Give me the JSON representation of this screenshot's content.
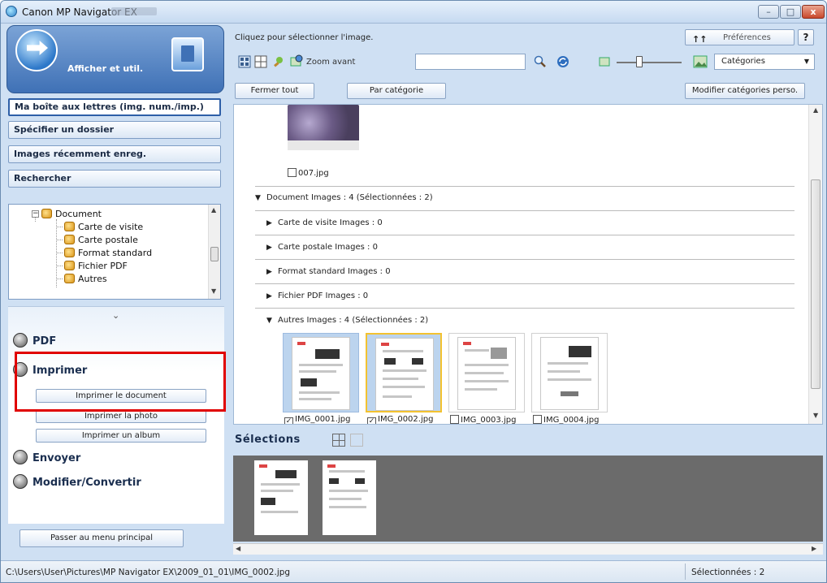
{
  "window": {
    "title": "Canon MP Navigator EX"
  },
  "left": {
    "header_title": "Afficher et util.",
    "nav": [
      {
        "label": "Ma boîte aux lettres (img. num./imp.)",
        "active": true
      },
      {
        "label": "Spécifier un dossier"
      },
      {
        "label": "Images récemment enreg."
      },
      {
        "label": "Rechercher"
      }
    ],
    "tree": {
      "root": "Document",
      "children": [
        "Carte de visite",
        "Carte postale",
        "Format standard",
        "Fichier PDF",
        "Autres"
      ]
    },
    "sections": {
      "pdf": "PDF",
      "print": "Imprimer",
      "print_doc": "Imprimer le document",
      "print_photo": "Imprimer la photo",
      "print_album": "Imprimer un album",
      "send": "Envoyer",
      "edit": "Modifier/Convertir"
    },
    "main_menu_btn": "Passer au menu principal"
  },
  "right": {
    "hint": "Cliquez pour sélectionner l'image.",
    "preferences": "Préférences",
    "help": "?",
    "zoom": "Zoom avant",
    "search_value": "",
    "select_value": "Catégories",
    "close_all": "Fermer tout",
    "by_category": "Par catégorie",
    "edit_categories": "Modifier catégories perso.",
    "photo_caption": "007.jpg",
    "groups": [
      {
        "text": "Document   Images : 4   (Sélectionnées : 2)"
      },
      {
        "text": "Carte de visite   Images : 0"
      },
      {
        "text": "Carte postale   Images : 0"
      },
      {
        "text": "Format standard   Images : 0"
      },
      {
        "text": "Fichier PDF   Images : 0"
      },
      {
        "text": "Autres   Images : 4   (Sélectionnées : 2)"
      }
    ],
    "thumbs": [
      {
        "name": "IMG_0001.jpg",
        "checked": true
      },
      {
        "name": "IMG_0002.jpg",
        "checked": true
      },
      {
        "name": "IMG_0003.jpg",
        "checked": false
      },
      {
        "name": "IMG_0004.jpg",
        "checked": false
      }
    ],
    "selections_title": "Sélections"
  },
  "status": {
    "path": "C:\\Users\\User\\Pictures\\MP Navigator EX\\2009_01_01\\IMG_0002.jpg",
    "count": "Sélectionnées : 2"
  },
  "colors": {
    "accent": "#3f71b6",
    "highlight": "#e00000",
    "selected": "#bcd4ee",
    "focus": "#f3c230"
  }
}
